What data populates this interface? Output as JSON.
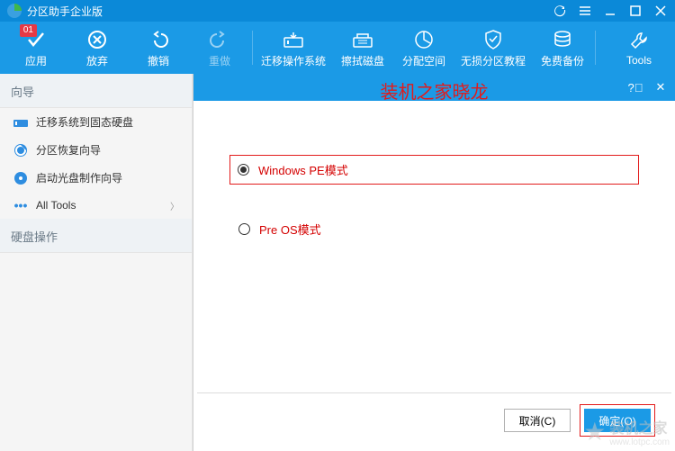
{
  "titlebar": {
    "title": "分区助手企业版"
  },
  "toolbar": {
    "apply": "应用",
    "apply_badge": "01",
    "discard": "放弃",
    "undo": "撤销",
    "redo": "重做",
    "migrate": "迁移操作系统",
    "wipe": "擦拭磁盘",
    "allocate": "分配空间",
    "tutorial": "无损分区教程",
    "backup": "免费备份",
    "tools": "Tools"
  },
  "sidebar": {
    "section1": "向导",
    "items": [
      {
        "label": "迁移系统到固态硬盘"
      },
      {
        "label": "分区恢复向导"
      },
      {
        "label": "启动光盘制作向导"
      },
      {
        "label": "All Tools"
      }
    ],
    "section2": "硬盘操作"
  },
  "dialog": {
    "overlay": "装机之家晓龙",
    "option1": "Windows PE模式",
    "option2": "Pre OS模式",
    "cancel": "取消(C)",
    "ok": "确定(O)"
  },
  "watermark": {
    "text": "装机之家",
    "url": "www.lotpc.com"
  }
}
